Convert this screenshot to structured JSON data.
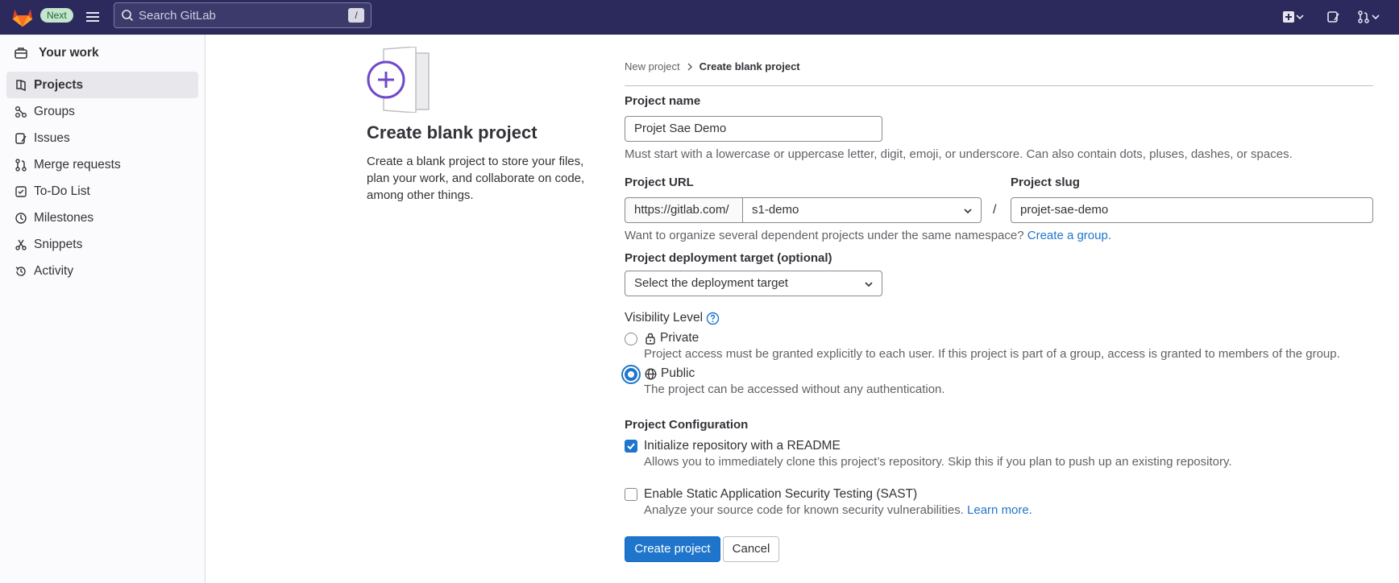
{
  "topbar": {
    "badge": "Next",
    "search_placeholder": "Search GitLab",
    "search_shortcut": "/",
    "brand_color": "#2c2a5c"
  },
  "sidebar": {
    "header": "Your work",
    "items": [
      {
        "label": "Projects",
        "icon": "project-icon",
        "active": true
      },
      {
        "label": "Groups",
        "icon": "group-icon"
      },
      {
        "label": "Issues",
        "icon": "issues-icon"
      },
      {
        "label": "Merge requests",
        "icon": "merge-request-icon"
      },
      {
        "label": "To-Do List",
        "icon": "todo-icon"
      },
      {
        "label": "Milestones",
        "icon": "clock-icon"
      },
      {
        "label": "Snippets",
        "icon": "snippet-icon"
      },
      {
        "label": "Activity",
        "icon": "history-icon"
      }
    ]
  },
  "description": {
    "title": "Create blank project",
    "text": "Create a blank project to store your files, plan your work, and collaborate on code, among other things."
  },
  "breadcrumb": {
    "parent": "New project",
    "current": "Create blank project"
  },
  "form": {
    "project_name_label": "Project name",
    "project_name_value": "Projet Sae Demo",
    "project_name_help": "Must start with a lowercase or uppercase letter, digit, emoji, or underscore. Can also contain dots, pluses, dashes, or spaces.",
    "project_url_label": "Project URL",
    "url_prefix": "https://gitlab.com/",
    "namespace_value": "s1-demo",
    "slash": "/",
    "project_slug_label": "Project slug",
    "project_slug_value": "projet-sae-demo",
    "namespace_help": "Want to organize several dependent projects under the same namespace?",
    "create_group_link": "Create a group.",
    "deployment_label": "Project deployment target (optional)",
    "deployment_value": "Select the deployment target",
    "visibility_label": "Visibility Level",
    "visibility_options": [
      {
        "label": "Private",
        "help": "Project access must be granted explicitly to each user. If this project is part of a group, access is granted to members of the group.",
        "selected": false
      },
      {
        "label": "Public",
        "help": "The project can be accessed without any authentication.",
        "selected": true
      }
    ],
    "config_label": "Project Configuration",
    "readme_label": "Initialize repository with a README",
    "readme_help": "Allows you to immediately clone this project’s repository. Skip this if you plan to push up an existing repository.",
    "readme_checked": true,
    "sast_label": "Enable Static Application Security Testing (SAST)",
    "sast_help": "Analyze your source code for known security vulnerabilities.",
    "sast_link": "Learn more.",
    "sast_checked": false,
    "create_button": "Create project",
    "cancel_button": "Cancel"
  }
}
